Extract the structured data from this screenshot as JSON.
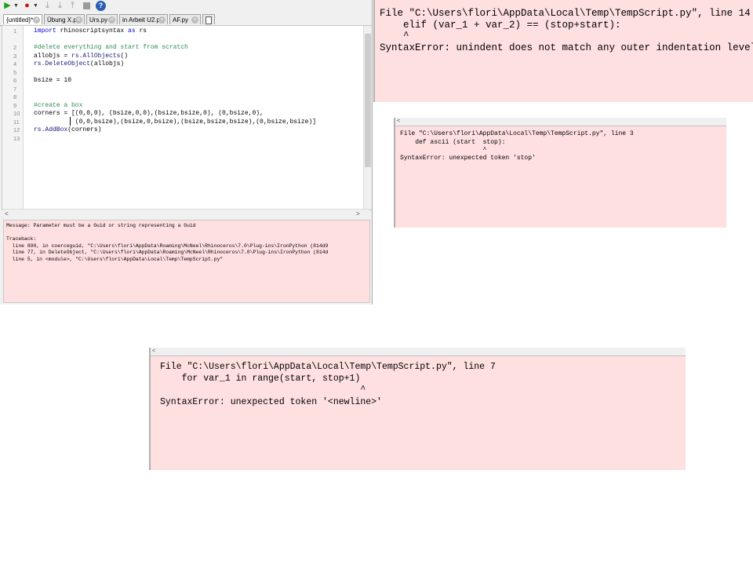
{
  "editor": {
    "toolbar": {
      "run_icon": "play-icon",
      "debug_icon": "record-icon",
      "step_icons": [
        "step-into-icon",
        "step-over-icon",
        "step-out-icon"
      ],
      "stop_icon": "stop-icon",
      "help_icon": "help-icon",
      "help_glyph": "?"
    },
    "tabs": [
      {
        "label": "{untitled}*",
        "active": true,
        "close": "×"
      },
      {
        "label": "Übung X.py",
        "active": false,
        "close": "×"
      },
      {
        "label": "Urs.py",
        "active": false,
        "close": "×"
      },
      {
        "label": "in Arbeit U2.py",
        "active": false,
        "close": "×"
      },
      {
        "label": "AF.py",
        "active": false,
        "close": "×"
      }
    ],
    "line_numbers": [
      "1",
      "2",
      "3",
      "4",
      "5",
      "6",
      "7",
      "8",
      "9",
      "10",
      "11",
      "12",
      "13"
    ],
    "code_lines": [
      {
        "kw1": "import",
        "text": " rhinoscriptsyntax ",
        "kw2": "as",
        "text2": " rs"
      },
      {
        "text": ""
      },
      {
        "text": ""
      },
      {
        "comment": "#delete everything and start from scratch"
      },
      {
        "text": "allobjs = ",
        "fn": "rs.AllObjects",
        "text2": "()"
      },
      {
        "fn": "rs.DeleteObject",
        "text2": "(allobjs)"
      },
      {
        "text": ""
      },
      {
        "text": "bsize = 10"
      },
      {
        "text": ""
      },
      {
        "text": ""
      },
      {
        "comment": "#create a box"
      },
      {
        "text": "corners = [(0,0,0), (bsize,0,0),(bsize,bsize,0), (0,bsize,0),"
      },
      {
        "text": "           (0,0,bsize),(bsize,0,bsize),(bsize,bsize,bsize),(0,bsize,bsize)]"
      },
      {
        "fn": "rs.AddBox",
        "text2": "(corners)"
      }
    ],
    "message": {
      "line1": "Message: Parameter must be a Guid or string representing a Guid",
      "traceback_label": "Traceback:",
      "tb1": "  line 890, in coerceguid, \"C:\\Users\\flori\\AppData\\Roaming\\McNeel\\Rhinoceros\\7.0\\Plug-ins\\IronPython (814d9",
      "tb2": "  line 77, in DeleteObject, \"C:\\Users\\flori\\AppData\\Roaming\\McNeel\\Rhinoceros\\7.0\\Plug-ins\\IronPython (814d",
      "tb3": "  line 5, in <module>, \"C:\\Users\\flori\\AppData\\Local\\Temp\\TempScript.py\""
    }
  },
  "error_top_right": {
    "file_line": "File \"C:\\Users\\flori\\AppData\\Local\\Temp\\TempScript.py\", line 14",
    "code": "    elif (var_1 + var_2) == (stop+start):",
    "caret": "    ^",
    "error": "SyntaxError: unindent does not match any outer indentation level"
  },
  "error_mid_right": {
    "file_line": "File \"C:\\Users\\flori\\AppData\\Local\\Temp\\TempScript.py\", line 3",
    "code": "    def ascii (start  stop):",
    "caret": "                      ^",
    "error": "SyntaxError: unexpected token 'stop'"
  },
  "error_bottom": {
    "file_line": "File \"C:\\Users\\flori\\AppData\\Local\\Temp\\TempScript.py\", line 7",
    "code": "    for var_1 in range(start, stop+1)",
    "caret": "                                     ^",
    "error": "SyntaxError: unexpected token '<newline>'"
  }
}
